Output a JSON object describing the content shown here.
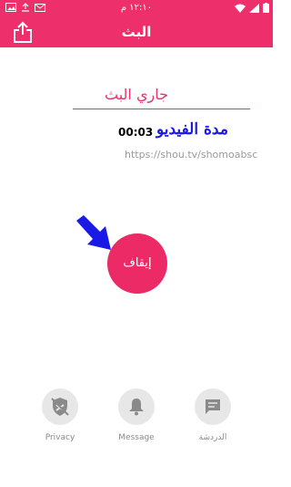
{
  "status_bar": {
    "time": "١٢:١٠ م"
  },
  "header": {
    "title": "البث"
  },
  "main": {
    "status_heading": "جاري البث",
    "duration_time": "00:03",
    "duration_label": "مدة الفيديو",
    "stream_url": "https://shou.tv/shomoabsc",
    "stop_button": "إيقاف"
  },
  "toolbar": {
    "privacy": "Privacy",
    "message": "Message",
    "chat": "الدردشة"
  },
  "colors": {
    "accent": "#ed2f6b",
    "annotation": "#1a1ae6"
  }
}
